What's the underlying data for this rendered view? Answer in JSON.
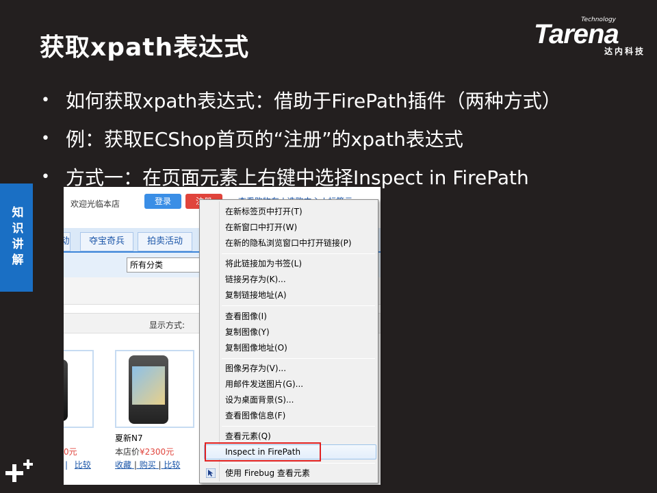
{
  "slide": {
    "title": "获取xpath表达式",
    "bullets": [
      "如何获取xpath表达式：借助于FirePath插件（两种方式）",
      "例：获取ECShop首页的“注册”的xpath表达式",
      "方式一：在页面元素上右键中选择Inspect in FirePath"
    ],
    "bullet_symbol": "•",
    "side_tab": "知识讲解"
  },
  "logo": {
    "tech": "Technology",
    "name": "Tarena",
    "sub": "达内科技"
  },
  "browser": {
    "welcome": "欢迎光临本店",
    "login": "登录",
    "register": "注册",
    "toplinks": "查看购物车 | 选购中心 | 标签云",
    "nav_tabs": [
      "动",
      "夺宝奇兵",
      "拍卖活动"
    ],
    "category_selected": "所有分类",
    "display_label": "显示方式:",
    "product_name": "夏新N7",
    "price_label": "本店价",
    "price_value": "¥2300元",
    "left_price": "0元",
    "actions": [
      "收藏",
      "购买",
      "比较"
    ],
    "left_actions": [
      "|",
      "比较"
    ]
  },
  "context_menu": {
    "groups": [
      [
        "在新标签页中打开(T)",
        "在新窗口中打开(W)",
        "在新的隐私浏览窗口中打开链接(P)"
      ],
      [
        "将此链接加为书签(L)",
        "链接另存为(K)...",
        "复制链接地址(A)"
      ],
      [
        "查看图像(I)",
        "复制图像(Y)",
        "复制图像地址(O)"
      ],
      [
        "图像另存为(V)...",
        "用邮件发送图片(G)...",
        "设为桌面背景(S)...",
        "查看图像信息(F)"
      ],
      [
        "查看元素(Q)",
        "Inspect in FirePath"
      ],
      [
        "使用 Firebug 查看元素"
      ]
    ]
  },
  "colors": {
    "background": "#231f1f",
    "side_tab": "#1a6fc4",
    "highlight_box": "#e02020"
  }
}
